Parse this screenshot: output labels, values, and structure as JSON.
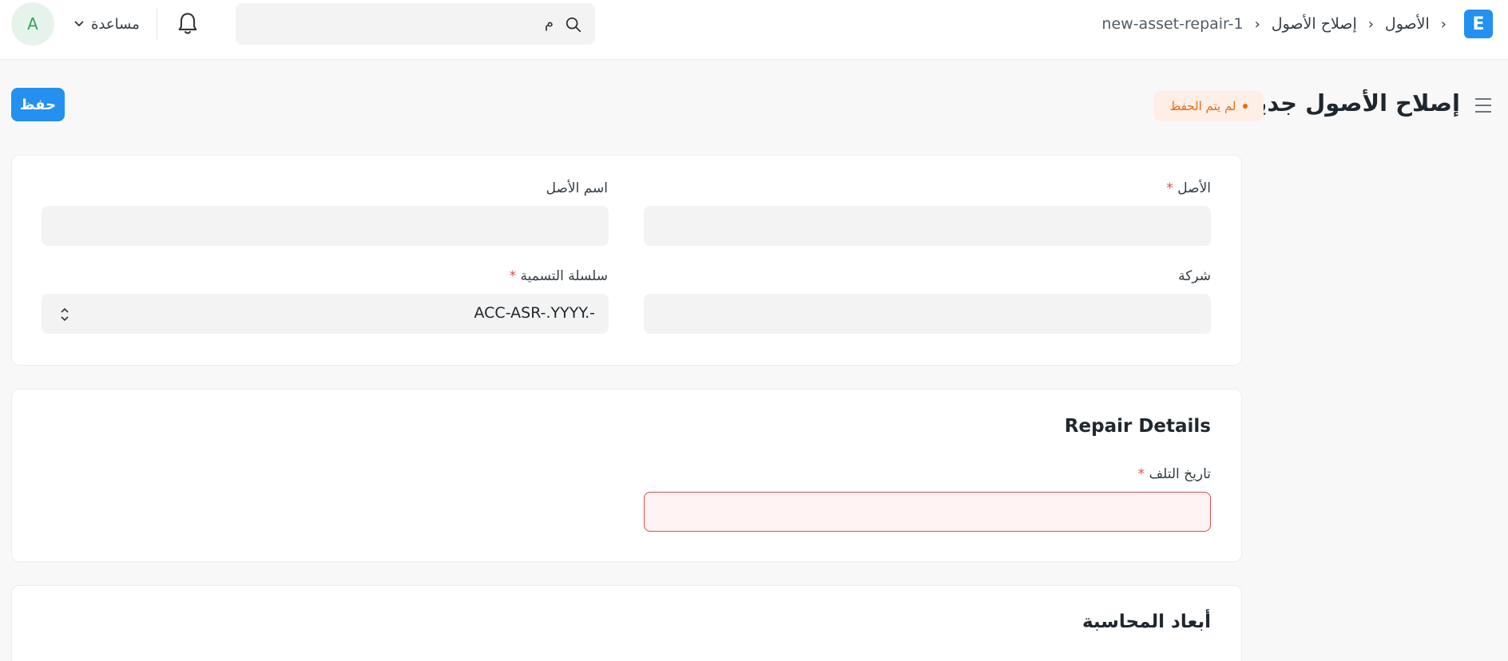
{
  "navbar": {
    "logo_letter": "E",
    "breadcrumbs": [
      "الأصول",
      "إصلاح الأصول",
      "new-asset-repair-1"
    ],
    "search_text": "م",
    "help_label": "مساعدة",
    "avatar_letter": "A"
  },
  "page": {
    "title": "إصلاح الأصول جديد",
    "status": "لم يتم الحفظ",
    "save_label": "حفظ"
  },
  "form": {
    "asset_label": "الأصل",
    "asset_name_label": "اسم الأصل",
    "company_label": "شركة",
    "naming_series_label": "سلسلة التسمية",
    "naming_series_value": "ACC-ASR-.YYYY.-",
    "required_marker": "*"
  },
  "sections": {
    "repair_details": "Repair Details",
    "failure_date_label": "تاريخ التلف",
    "accounting_dimensions": "أبعاد المحاسبة"
  },
  "colors": {
    "accent": "#2490ef",
    "status_orange": "#e86c13",
    "error_red": "#e24c4c"
  }
}
